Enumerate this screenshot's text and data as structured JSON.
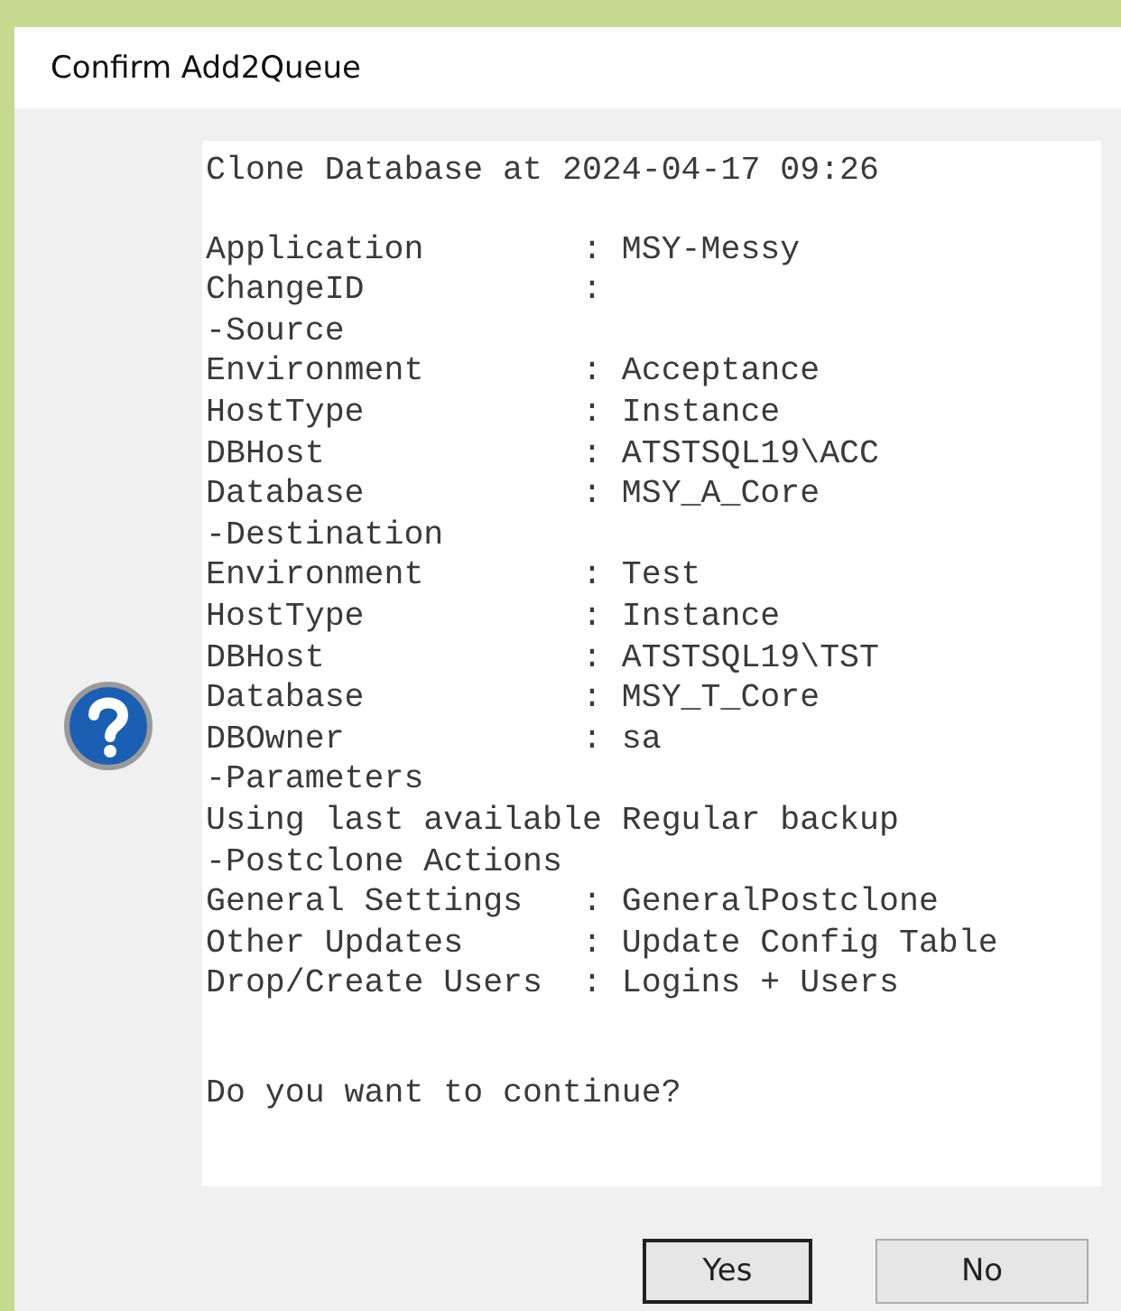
{
  "window": {
    "title": "Confirm Add2Queue"
  },
  "message": {
    "paragraphs": [
      {
        "kind": "heading",
        "lines": [
          "Clone Database at 2024-04-17 09:26"
        ]
      },
      {
        "kind": "body",
        "lines": [
          "Application        : MSY-Messy",
          "ChangeID           :",
          "-Source",
          "Environment        : Acceptance",
          "HostType           : Instance",
          "DBHost             : ATSTSQL19\\ACC",
          "Database           : MSY_A_Core",
          "-Destination",
          "Environment        : Test",
          "HostType           : Instance",
          "DBHost             : ATSTSQL19\\TST",
          "Database           : MSY_T_Core",
          "DBOwner            : sa",
          "-Parameters",
          "Using last available Regular backup",
          "-Postclone Actions",
          "General Settings   : GeneralPostclone",
          "Other Updates      : Update Config Table",
          "Drop/Create Users  : Logins + Users"
        ]
      },
      {
        "kind": "question",
        "lines": [
          "Do you want to continue?"
        ]
      }
    ]
  },
  "buttons": [
    {
      "label": "Yes",
      "selected": true
    },
    {
      "label": "No",
      "selected": false
    }
  ]
}
